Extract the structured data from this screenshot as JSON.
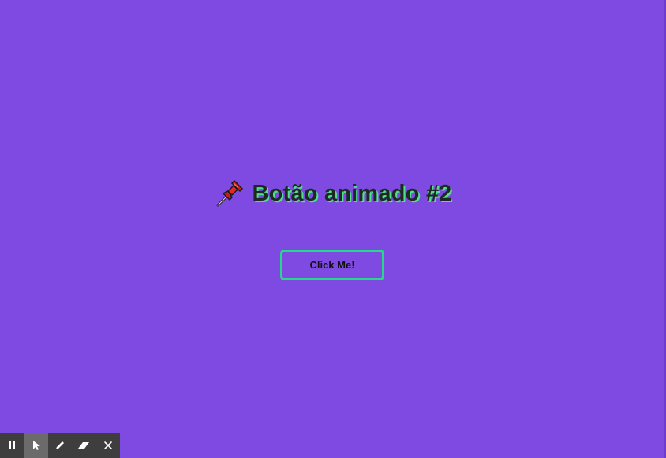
{
  "page": {
    "title_icon": "pushpin-icon",
    "title": "Botão animado #2",
    "button_label": "Click Me!"
  },
  "colors": {
    "background": "#7e4ae1",
    "accent_green": "#27d889",
    "title_text": "#1d2a22",
    "title_shadow": "#4fe08c",
    "toolbar": "#3e3e3e",
    "toolbar_active": "#6b6b6b"
  },
  "toolbar": {
    "items": [
      {
        "icon": "pause-icon",
        "active": false
      },
      {
        "icon": "cursor-icon",
        "active": true
      },
      {
        "icon": "pencil-icon",
        "active": false
      },
      {
        "icon": "eraser-icon",
        "active": false
      },
      {
        "icon": "close-icon",
        "active": false
      }
    ]
  }
}
